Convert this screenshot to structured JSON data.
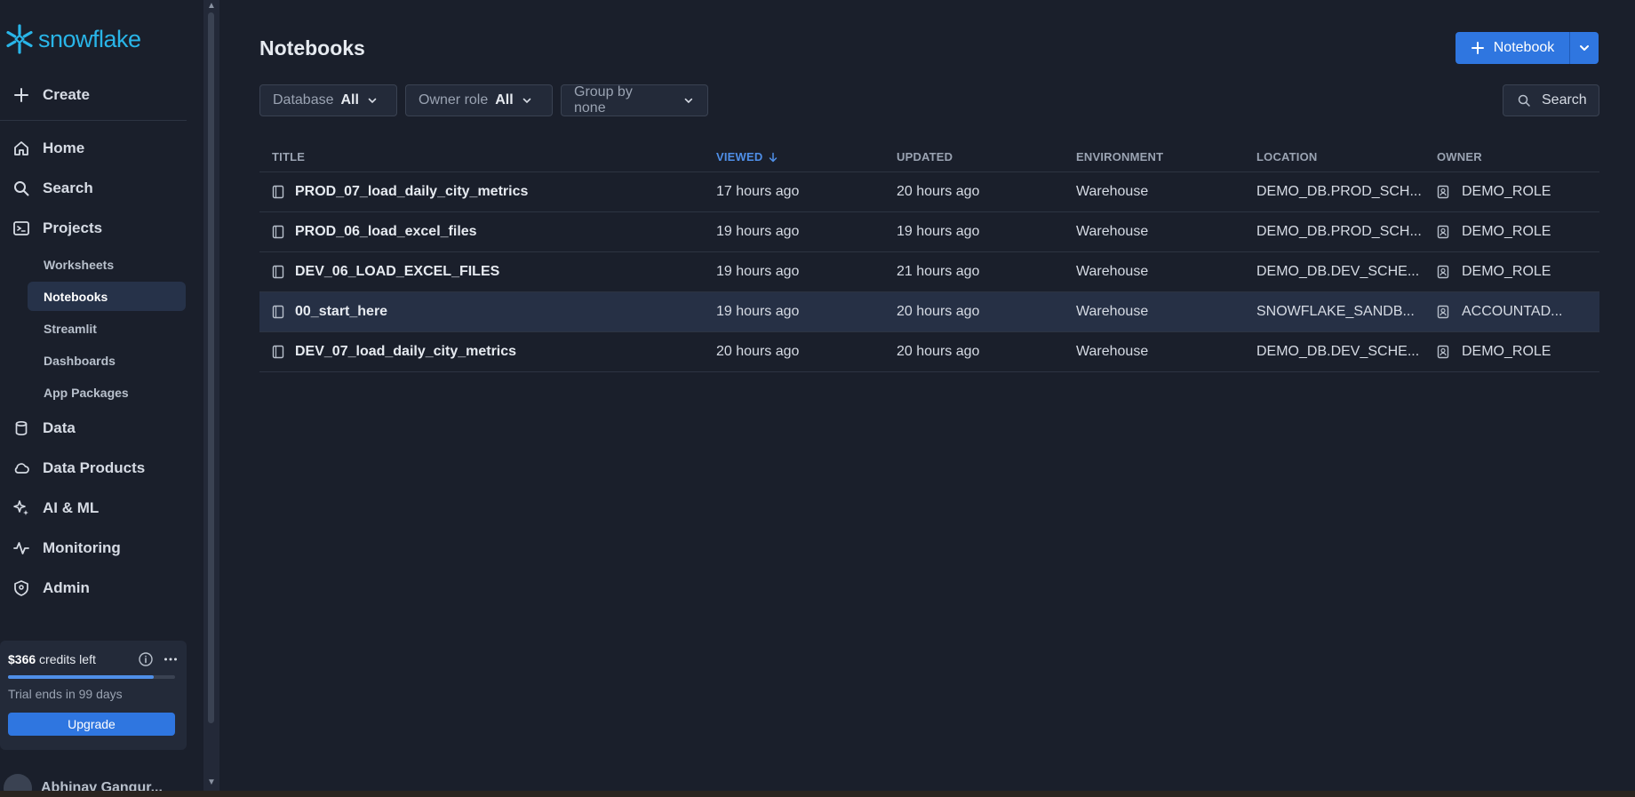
{
  "brand": {
    "name": "snowflake",
    "color": "#29b5e8"
  },
  "sidebar": {
    "create_label": "Create",
    "items": [
      {
        "label": "Home",
        "icon": "home-icon"
      },
      {
        "label": "Search",
        "icon": "search-icon"
      },
      {
        "label": "Projects",
        "icon": "terminal-icon"
      }
    ],
    "project_items": [
      {
        "label": "Worksheets",
        "active": false
      },
      {
        "label": "Notebooks",
        "active": true
      },
      {
        "label": "Streamlit",
        "active": false
      },
      {
        "label": "Dashboards",
        "active": false
      },
      {
        "label": "App Packages",
        "active": false
      }
    ],
    "items_bottom": [
      {
        "label": "Data",
        "icon": "database-icon"
      },
      {
        "label": "Data Products",
        "icon": "cloud-icon"
      },
      {
        "label": "AI & ML",
        "icon": "sparkle-icon"
      },
      {
        "label": "Monitoring",
        "icon": "activity-icon"
      },
      {
        "label": "Admin",
        "icon": "shield-icon"
      }
    ],
    "credits": {
      "amount": "$366",
      "suffix": "credits left",
      "progress_fraction": 0.87,
      "trial_text": "Trial ends in 99 days",
      "upgrade_label": "Upgrade"
    },
    "user_name": "Abhinav Gangur..."
  },
  "main": {
    "title": "Notebooks",
    "new_button_label": "Notebook",
    "filters": [
      {
        "label": "Database",
        "value": "All"
      },
      {
        "label": "Owner role",
        "value": "All"
      },
      {
        "label": "Group by none",
        "value": ""
      }
    ],
    "search_label": "Search",
    "table": {
      "headers": {
        "title": "TITLE",
        "viewed": "VIEWED",
        "updated": "UPDATED",
        "environment": "ENVIRONMENT",
        "location": "LOCATION",
        "owner": "OWNER"
      },
      "rows": [
        {
          "title": "PROD_07_load_daily_city_metrics",
          "viewed": "17 hours ago",
          "updated": "20 hours ago",
          "environment": "Warehouse",
          "location": "DEMO_DB.PROD_SCH...",
          "owner": "DEMO_ROLE"
        },
        {
          "title": "PROD_06_load_excel_files",
          "viewed": "19 hours ago",
          "updated": "19 hours ago",
          "environment": "Warehouse",
          "location": "DEMO_DB.PROD_SCH...",
          "owner": "DEMO_ROLE"
        },
        {
          "title": "DEV_06_LOAD_EXCEL_FILES",
          "viewed": "19 hours ago",
          "updated": "21 hours ago",
          "environment": "Warehouse",
          "location": "DEMO_DB.DEV_SCHE...",
          "owner": "DEMO_ROLE"
        },
        {
          "title": "00_start_here",
          "viewed": "19 hours ago",
          "updated": "20 hours ago",
          "environment": "Warehouse",
          "location": "SNOWFLAKE_SANDB...",
          "owner": "ACCOUNTAD..."
        },
        {
          "title": "DEV_07_load_daily_city_metrics",
          "viewed": "20 hours ago",
          "updated": "20 hours ago",
          "environment": "Warehouse",
          "location": "DEMO_DB.DEV_SCHE...",
          "owner": "DEMO_ROLE"
        }
      ]
    }
  }
}
